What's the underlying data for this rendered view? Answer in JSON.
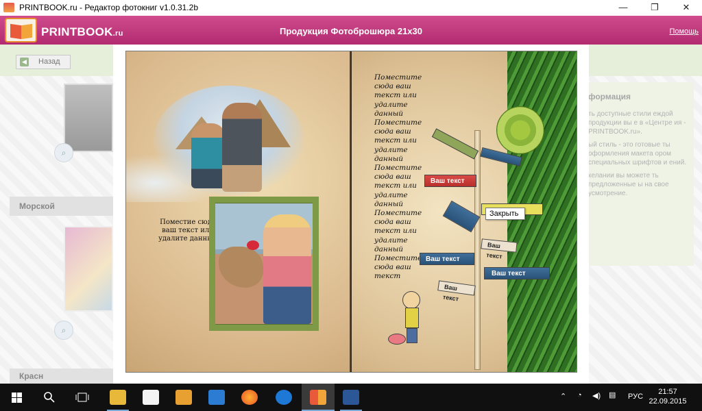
{
  "window": {
    "title": "PRINTBOOK.ru - Редактор фотокниг v1.0.31.2b",
    "minimize": "—",
    "maximize": "❐",
    "close": "✕"
  },
  "app": {
    "logo_main": "PRINTBOOK",
    "logo_suffix": ".ru",
    "title": "Продукция Фотоброшюра 21x30",
    "help": "Помощь"
  },
  "background_panel": {
    "back_label": "Назад",
    "categories": [
      "Морской",
      "Красн"
    ],
    "info_title": "формация",
    "info_paragraphs": [
      "ть доступные стили еждой продукции вы е в «Центре ия - PRINTBOOK.ru».",
      "ый стиль - это готовые ты оформления макета ором специальных шрифтов и ений.",
      "келании вы можете ть предложенные ы на свое усмотрение."
    ]
  },
  "book": {
    "left_caption": "Поместие сюда ваш текст или удалите данный",
    "right_text": "Поместите сюда ваш текст или удалите данный Поместите сюда ваш текст или удалите данный Поместите сюда ваш текст или удалите данный Поместите сюда ваш текст или удалите данный Поместите сюда ваш текст",
    "signs": {
      "red": "Ваш текст",
      "blue1": "Ваш текст",
      "blue2": "Ваш текст",
      "beige1": "Ваш текст",
      "beige2": "Ваш текст"
    },
    "tooltip": "Закрыть"
  },
  "taskbar": {
    "language": "РУС",
    "time": "21:57",
    "date": "22.09.2015"
  },
  "colors": {
    "header_accent": "#b22a70",
    "taskbar": "#101010"
  }
}
